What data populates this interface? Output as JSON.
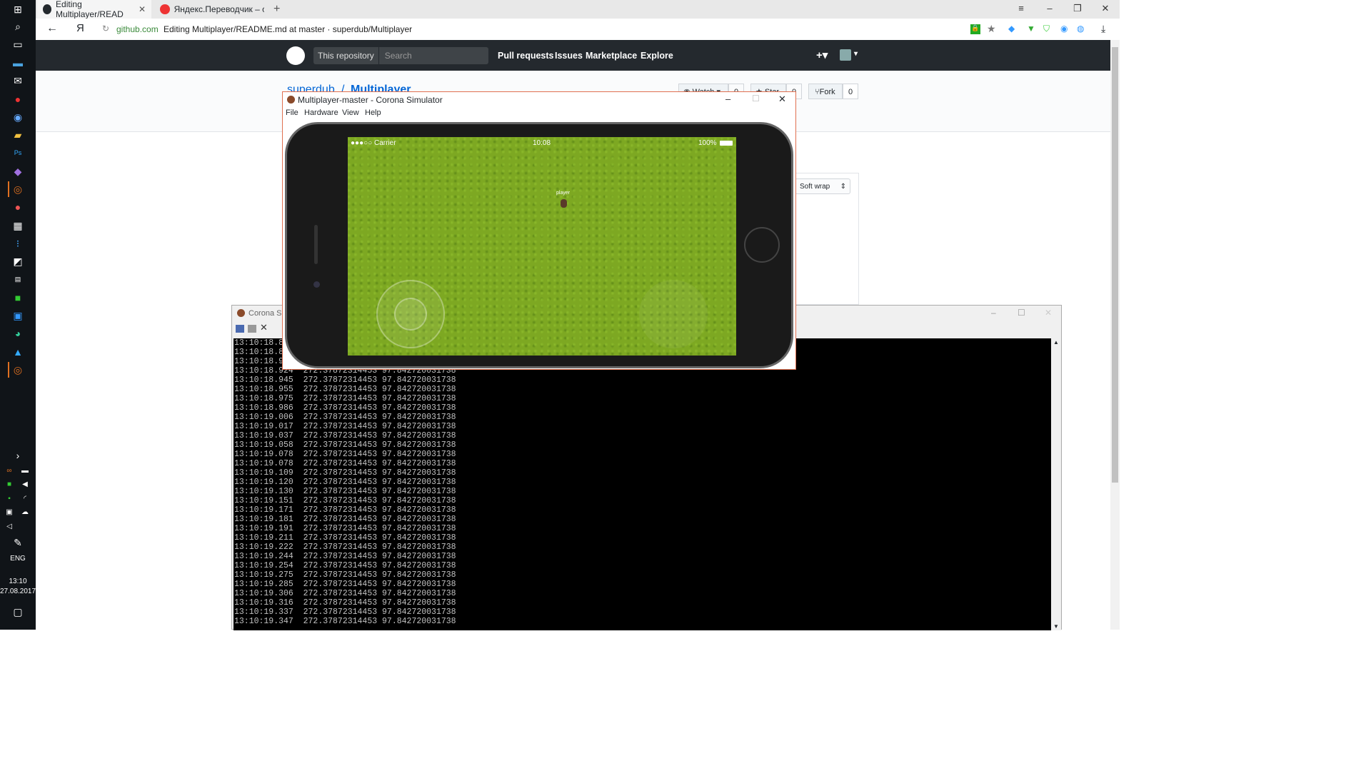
{
  "taskbar": {
    "icons": [
      "windows-start-icon",
      "search-icon",
      "task-view-icon",
      "monitor-icon",
      "mail-icon",
      "yandex-browser-icon",
      "steam-icon",
      "folder-icon",
      "photoshop-icon",
      "visual-studio-icon",
      "corona-icon",
      "app-icon",
      "calculator-icon",
      "trello-icon",
      "app-icon",
      "app-icon",
      "app-icon",
      "app-icon",
      "app-icon",
      "app-icon",
      "corona-icon"
    ],
    "language": "ENG",
    "time": "13:10",
    "date": "27.08.2017"
  },
  "browser": {
    "tabs": [
      {
        "title": "Editing Multiplayer/READ",
        "favicon": "github-icon",
        "active": true
      },
      {
        "title": "Яндекс.Переводчик – слов",
        "favicon": "yandex-translate-icon",
        "active": false
      }
    ],
    "back_icon": "←",
    "yandex_logo": "Я",
    "url_domain": "github.com",
    "url_title": "Editing Multiplayer/README.md at master · superdub/Multiplayer"
  },
  "github": {
    "search_scope": "This repository",
    "search_placeholder": "Search",
    "nav": [
      "Pull requests",
      "Issues",
      "Marketplace",
      "Explore"
    ],
    "repo_owner": "superdub",
    "repo_name": "Multiplayer",
    "watch_label": "Watch",
    "watch_count": "0",
    "star_label": "Star",
    "star_count": "0",
    "fork_label": "Fork",
    "fork_count": "0",
    "softwrap_label": "Soft wrap"
  },
  "simulator": {
    "title": "Multiplayer-master - Corona Simulator",
    "menu": [
      "File",
      "Hardware",
      "View",
      "Help"
    ],
    "status_carrier": "●●●○○ Carrier",
    "status_time": "10:08",
    "status_battery": "100%",
    "player_label": "player"
  },
  "console": {
    "title": "Corona Si",
    "log_prefix_lines": [
      "13:10:18.88",
      "13:10:18.89",
      "13:10:18.9"
    ],
    "log_lines": [
      "13:10:18.924  272.37872314453 97.842720031738",
      "13:10:18.945  272.37872314453 97.842720031738",
      "13:10:18.955  272.37872314453 97.842720031738",
      "13:10:18.975  272.37872314453 97.842720031738",
      "13:10:18.986  272.37872314453 97.842720031738",
      "13:10:19.006  272.37872314453 97.842720031738",
      "13:10:19.017  272.37872314453 97.842720031738",
      "13:10:19.037  272.37872314453 97.842720031738",
      "13:10:19.058  272.37872314453 97.842720031738",
      "13:10:19.078  272.37872314453 97.842720031738",
      "13:10:19.078  272.37872314453 97.842720031738",
      "13:10:19.109  272.37872314453 97.842720031738",
      "13:10:19.120  272.37872314453 97.842720031738",
      "13:10:19.130  272.37872314453 97.842720031738",
      "13:10:19.151  272.37872314453 97.842720031738",
      "13:10:19.171  272.37872314453 97.842720031738",
      "13:10:19.181  272.37872314453 97.842720031738",
      "13:10:19.191  272.37872314453 97.842720031738",
      "13:10:19.211  272.37872314453 97.842720031738",
      "13:10:19.222  272.37872314453 97.842720031738",
      "13:10:19.244  272.37872314453 97.842720031738",
      "13:10:19.254  272.37872314453 97.842720031738",
      "13:10:19.275  272.37872314453 97.842720031738",
      "13:10:19.285  272.37872314453 97.842720031738",
      "13:10:19.306  272.37872314453 97.842720031738",
      "13:10:19.316  272.37872314453 97.842720031738",
      "13:10:19.337  272.37872314453 97.842720031738",
      "13:10:19.347  272.37872314453 97.842720031738"
    ]
  },
  "colors": {
    "taskbar": "#101418",
    "github_header": "#24292e",
    "grass": "#7da822",
    "accent": "#e07020"
  }
}
